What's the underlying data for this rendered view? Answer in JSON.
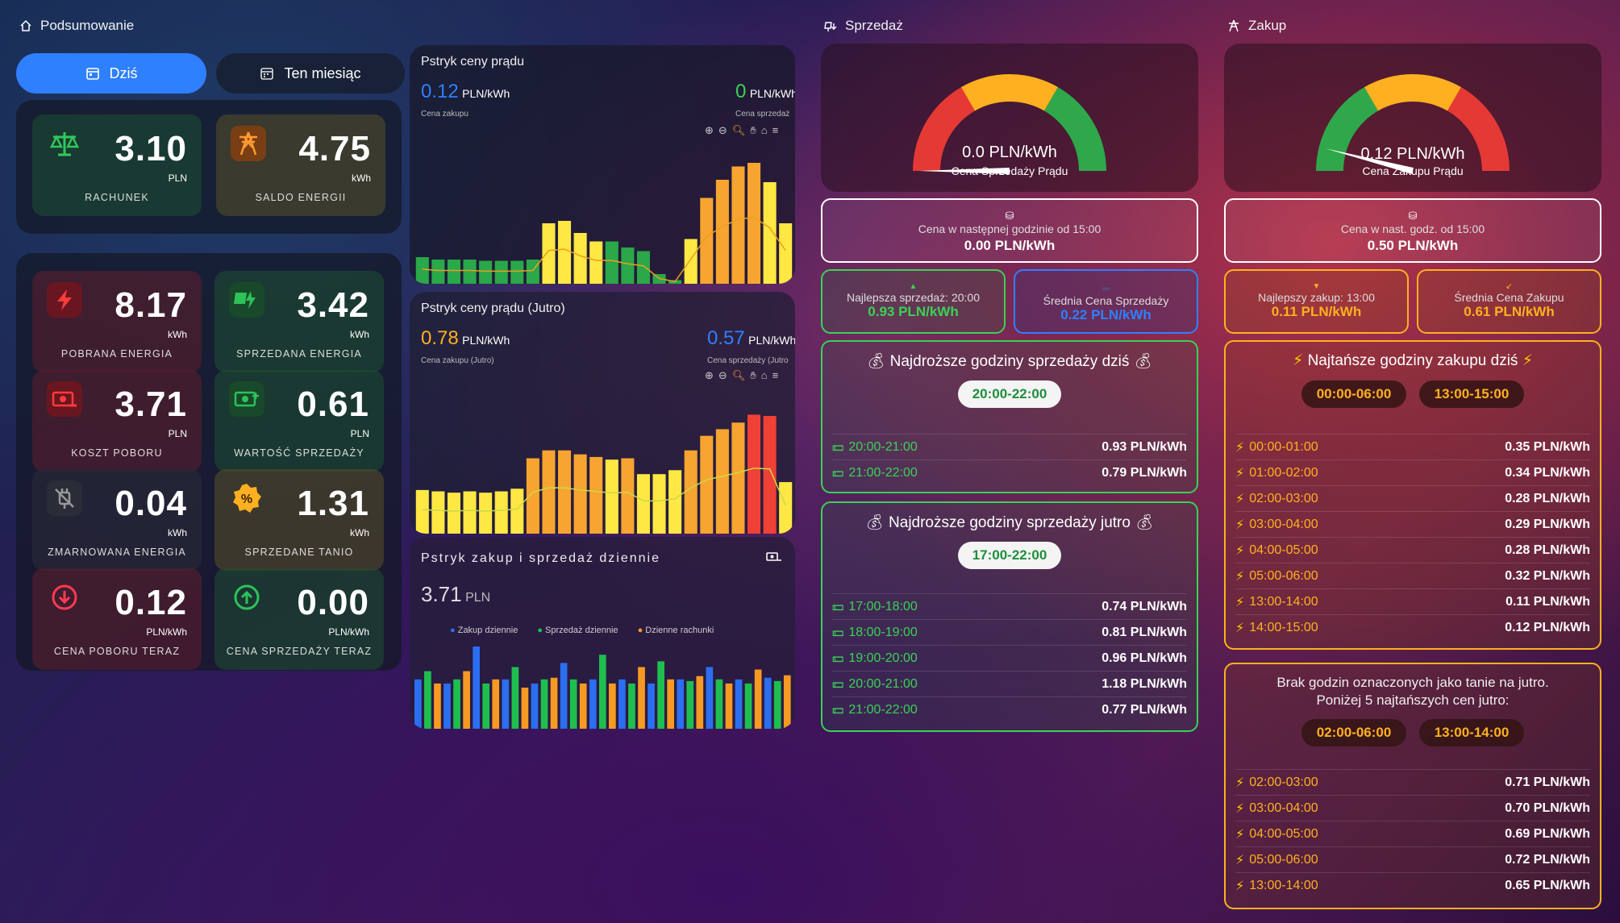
{
  "summary": {
    "header": "Podsumowanie",
    "tab_today": "Dziś",
    "tab_month": "Ten miesiąc",
    "top_tiles": [
      {
        "value": "3.10",
        "unit": "PLN",
        "label": "RACHUNEK"
      },
      {
        "value": "4.75",
        "unit": "kWh",
        "label": "SALDO ENERGII"
      }
    ],
    "tiles": [
      {
        "value": "8.17",
        "unit": "kWh",
        "label": "POBRANA ENERGIA"
      },
      {
        "value": "3.42",
        "unit": "kWh",
        "label": "SPRZEDANA ENERGIA"
      },
      {
        "value": "3.71",
        "unit": "PLN",
        "label": "KOSZT POBORU"
      },
      {
        "value": "0.61",
        "unit": "PLN",
        "label": "WARTOŚĆ SPRZEDAŻY"
      },
      {
        "value": "0.04",
        "unit": "kWh",
        "label": "ZMARNOWANA ENERGIA"
      },
      {
        "value": "1.31",
        "unit": "kWh",
        "label": "SPRZEDANE TANIO"
      },
      {
        "value": "0.12",
        "unit": "PLN/kWh",
        "label": "CENA POBORU TERAZ"
      },
      {
        "value": "0.00",
        "unit": "PLN/kWh",
        "label": "CENA SPRZEDAŻY TERAZ"
      }
    ]
  },
  "chart_today": {
    "title": "Pstryk ceny prądu",
    "buy_value": "0.12",
    "buy_unit": "PLN/kWh",
    "buy_label": "Cena zakupu",
    "sell_value": "0",
    "sell_unit": "PLN/kWh",
    "sell_label": "Cena sprzedaż"
  },
  "chart_tomorrow": {
    "title": "Pstryk ceny prądu (Jutro)",
    "buy_value": "0.78",
    "buy_unit": "PLN/kWh",
    "buy_label": "Cena zakupu (Jutro)",
    "sell_value": "0.57",
    "sell_unit": "PLN/kWh",
    "sell_label": "Cena sprzedaży (Jutro"
  },
  "chart_daily": {
    "title": "Pstryk zakup i sprzedaż dziennie",
    "value": "3.71",
    "unit": "PLN",
    "legend": [
      "Zakup dziennie",
      "Sprzedaż dziennie",
      "Dzienne rachunki"
    ]
  },
  "chart_data": [
    {
      "type": "bar",
      "name_ref": "today",
      "values": [
        0.22,
        0.2,
        0.2,
        0.2,
        0.19,
        0.19,
        0.19,
        0.2,
        0.5,
        0.52,
        0.42,
        0.35,
        0.35,
        0.3,
        0.27,
        0.08,
        0.03,
        0.37,
        0.71,
        0.86,
        0.97,
        1.0,
        0.84,
        0.5
      ],
      "colors": [
        "#2aa84a",
        "#2aa84a",
        "#2aa84a",
        "#2aa84a",
        "#2aa84a",
        "#2aa84a",
        "#2aa84a",
        "#2aa84a",
        "#ffe843",
        "#ffe843",
        "#ffe843",
        "#ffe843",
        "#2aa84a",
        "#2aa84a",
        "#2aa84a",
        "#2aa84a",
        "#2aa84a",
        "#ffe843",
        "#f7a530",
        "#f7a530",
        "#f7a530",
        "#f7a530",
        "#ffe843",
        "#ffe843"
      ]
    },
    {
      "type": "bar",
      "name_ref": "tomorrow",
      "values": [
        0.33,
        0.32,
        0.31,
        0.32,
        0.31,
        0.32,
        0.34,
        0.57,
        0.63,
        0.63,
        0.6,
        0.58,
        0.56,
        0.57,
        0.45,
        0.45,
        0.48,
        0.63,
        0.74,
        0.79,
        0.84,
        0.9,
        0.89,
        0.39
      ],
      "colors": [
        "#ffe843",
        "#ffe843",
        "#ffe843",
        "#ffe843",
        "#ffe843",
        "#ffe843",
        "#ffe843",
        "#f7a530",
        "#f7a530",
        "#f7a530",
        "#f7a530",
        "#f7a530",
        "#ffe843",
        "#f7a530",
        "#ffe843",
        "#ffe843",
        "#ffe843",
        "#f7a530",
        "#f7a530",
        "#f7a530",
        "#f7a530",
        "#ef4136",
        "#ef4136",
        "#ffe843"
      ]
    },
    {
      "type": "bar",
      "name_ref": "daily",
      "series_colors": [
        "#2b6ef0",
        "#1ebf4f",
        "#f79a24"
      ],
      "values": [
        [
          0.6,
          0.7,
          0.55
        ],
        [
          0.55,
          0.6,
          0.7
        ],
        [
          1.0,
          0.55,
          0.6
        ],
        [
          0.6,
          0.75,
          0.5
        ],
        [
          0.55,
          0.6,
          0.62
        ],
        [
          0.8,
          0.6,
          0.55
        ],
        [
          0.6,
          0.9,
          0.55
        ],
        [
          0.6,
          0.55,
          0.75
        ],
        [
          0.55,
          0.82,
          0.6
        ],
        [
          0.6,
          0.58,
          0.64
        ],
        [
          0.75,
          0.6,
          0.55
        ],
        [
          0.6,
          0.55,
          0.72
        ],
        [
          0.62,
          0.58,
          0.65
        ]
      ]
    }
  ],
  "sell": {
    "header": "Sprzedaż",
    "gauge_value": "0.0 PLN/kWh",
    "gauge_label": "Cena Sprzedaży Prądu",
    "gauge_fraction": 0.0,
    "next_label": "Cena w następnej godzinie od 15:00",
    "next_value": "0.00 PLN/kWh",
    "best_label": "Najlepsza sprzedaż: 20:00",
    "best_value": "0.93 PLN/kWh",
    "avg_label": "Średnia Cena Sprzedaży",
    "avg_value": "0.22 PLN/kWh",
    "today_title": "Najdroższe godziny sprzedaży dziś",
    "today_pill": "20:00-22:00",
    "today_rows": [
      {
        "time": "20:00-21:00",
        "price": "0.93 PLN/kWh"
      },
      {
        "time": "21:00-22:00",
        "price": "0.79 PLN/kWh"
      }
    ],
    "tomorrow_title": "Najdroższe godziny sprzedaży jutro",
    "tomorrow_pill": "17:00-22:00",
    "tomorrow_rows": [
      {
        "time": "17:00-18:00",
        "price": "0.74 PLN/kWh"
      },
      {
        "time": "18:00-19:00",
        "price": "0.81 PLN/kWh"
      },
      {
        "time": "19:00-20:00",
        "price": "0.96 PLN/kWh"
      },
      {
        "time": "20:00-21:00",
        "price": "1.18 PLN/kWh"
      },
      {
        "time": "21:00-22:00",
        "price": "0.77 PLN/kWh"
      }
    ]
  },
  "buy": {
    "header": "Zakup",
    "gauge_value": "0.12 PLN/kWh",
    "gauge_label": "Cena Zakupu Prądu",
    "gauge_fraction": 0.08,
    "next_label": "Cena w nast. godz. od 15:00",
    "next_value": "0.50 PLN/kWh",
    "best_label": "Najlepszy zakup: 13:00",
    "best_value": "0.11 PLN/kWh",
    "avg_label": "Średnia Cena Zakupu",
    "avg_value": "0.61 PLN/kWh",
    "today_title": "Najtańsze godziny zakupu dziś",
    "today_pills": [
      "00:00-06:00",
      "13:00-15:00"
    ],
    "today_rows": [
      {
        "time": "00:00-01:00",
        "price": "0.35 PLN/kWh"
      },
      {
        "time": "01:00-02:00",
        "price": "0.34 PLN/kWh"
      },
      {
        "time": "02:00-03:00",
        "price": "0.28 PLN/kWh"
      },
      {
        "time": "03:00-04:00",
        "price": "0.29 PLN/kWh"
      },
      {
        "time": "04:00-05:00",
        "price": "0.28 PLN/kWh"
      },
      {
        "time": "05:00-06:00",
        "price": "0.32 PLN/kWh"
      },
      {
        "time": "13:00-14:00",
        "price": "0.11 PLN/kWh"
      },
      {
        "time": "14:00-15:00",
        "price": "0.12 PLN/kWh"
      }
    ],
    "tomorrow_line1": "Brak godzin oznaczonych jako tanie na jutro.",
    "tomorrow_line2": "Poniżej 5 najtańszych cen jutro:",
    "tomorrow_pills": [
      "02:00-06:00",
      "13:00-14:00"
    ],
    "tomorrow_rows": [
      {
        "time": "02:00-03:00",
        "price": "0.71 PLN/kWh"
      },
      {
        "time": "03:00-04:00",
        "price": "0.70 PLN/kWh"
      },
      {
        "time": "04:00-05:00",
        "price": "0.69 PLN/kWh"
      },
      {
        "time": "05:00-06:00",
        "price": "0.72 PLN/kWh"
      },
      {
        "time": "13:00-14:00",
        "price": "0.65 PLN/kWh"
      }
    ]
  },
  "colors": {
    "accent_blue": "#2f80ff",
    "green": "#39d353",
    "orange": "#ffb020",
    "red": "#e53935"
  }
}
